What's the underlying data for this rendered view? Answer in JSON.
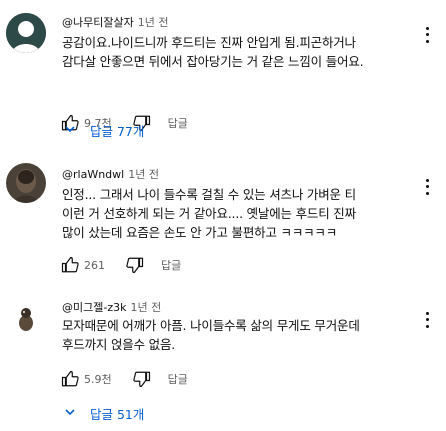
{
  "comments": [
    {
      "author": "@나무티잘살자",
      "time": "1년 전",
      "lines": [
        "공감이요.나이드니까 후드티는 진짜 안입게 됨.피곤하거나",
        "감다살 안좋으면 뒤에서 잡아당기는 거 같은 느낌이 들어요."
      ],
      "likes": "9.7천",
      "reply_label": "답글",
      "replies_toggle": "답글 77개"
    },
    {
      "author": "@rlaWndwl",
      "time": "1년 전",
      "lines": [
        "인정... 그래서 나이 들수록 걸칠 수 있는 셔츠나 가벼운 티",
        "이런 거 선호하게 되는 거 같아요.... 옛날에는 후드티 진짜",
        "많이 샀는데 요즘은 손도 안 가고 불편하고 ㅋㅋㅋㅋㅋ"
      ],
      "likes": "261",
      "reply_label": "답글"
    },
    {
      "author": "@미그젤-z3k",
      "time": "1년 전",
      "lines": [
        "모자때문에 어깨가 아픔. 나이들수록 삶의 무게도 무거운데",
        "후드까지 얹을수 없음."
      ],
      "likes": "5.9천",
      "reply_label": "답글",
      "replies_toggle": "답글 51개"
    }
  ],
  "colors": {
    "link": "#065fd4",
    "meta": "#606060",
    "text": "#0f0f0f"
  },
  "icons": [
    "like-icon",
    "dislike-icon",
    "more-vert-icon",
    "chevron-down-icon"
  ]
}
